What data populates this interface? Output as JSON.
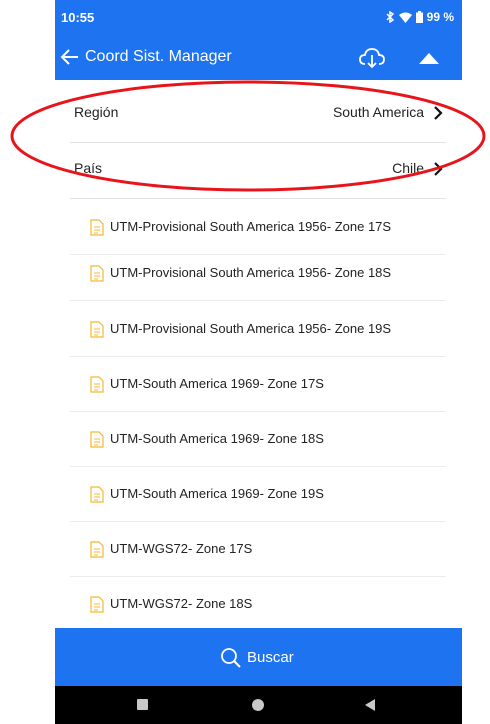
{
  "status": {
    "time": "10:55",
    "battery": "99 %"
  },
  "toolbar": {
    "title": "Coord Sist. Manager"
  },
  "region": {
    "label": "Región",
    "value": "South America"
  },
  "country": {
    "label": "País",
    "value": "Chile"
  },
  "systems": [
    "UTM-Provisional South America 1956- Zone 17S",
    "UTM-Provisional South America 1956- Zone 18S",
    "UTM-Provisional South America 1956- Zone 19S",
    "UTM-South America 1969- Zone 17S",
    "UTM-South America 1969- Zone 18S",
    "UTM-South America 1969- Zone 19S",
    "UTM-WGS72- Zone 17S",
    "UTM-WGS72- Zone 18S"
  ],
  "search": {
    "label": "Buscar"
  },
  "colors": {
    "primary": "#1e73f0",
    "annotation": "#e8141b",
    "doc_icon": "#f5b731"
  }
}
